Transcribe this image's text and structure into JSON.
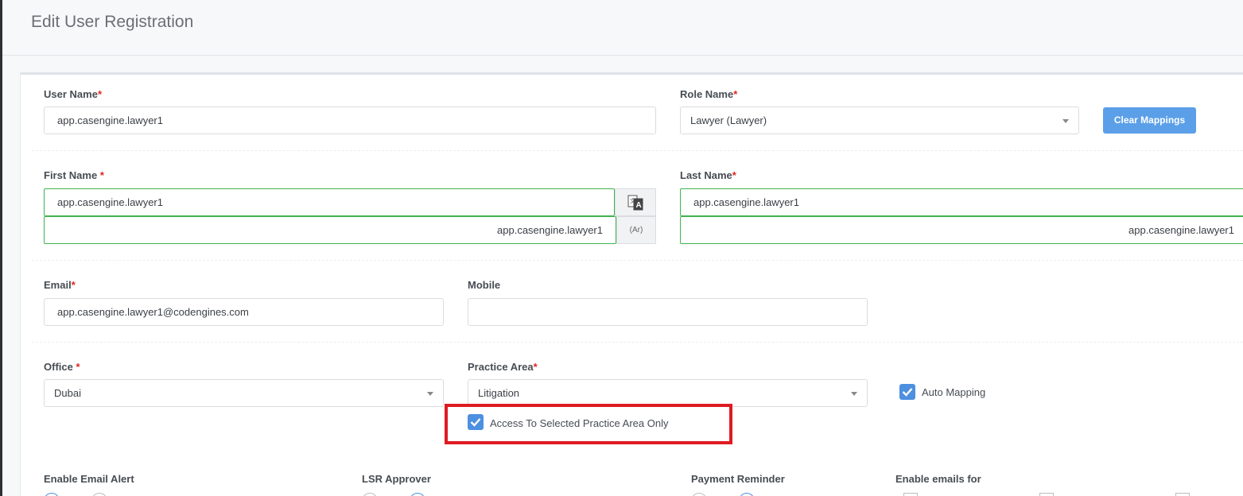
{
  "page": {
    "title": "Edit User Registration"
  },
  "form": {
    "user_name": {
      "label": "User Name",
      "required": "*",
      "value": "app.casengine.lawyer1"
    },
    "role_name": {
      "label": "Role Name",
      "required": "*",
      "value": "Lawyer (Lawyer)"
    },
    "clear_mappings_label": "Clear Mappings",
    "first_name": {
      "label": "First Name ",
      "required": "*",
      "value": "app.casengine.lawyer1",
      "value_ar": "app.casengine.lawyer1",
      "ar_tag": "(Ar)"
    },
    "last_name": {
      "label": "Last Name",
      "required": "*",
      "value": "app.casengine.lawyer1",
      "value_ar": "app.casengine.lawyer1"
    },
    "email": {
      "label": "Email",
      "required": "*",
      "value": "app.casengine.lawyer1@codengines.com"
    },
    "mobile": {
      "label": "Mobile",
      "value": ""
    },
    "office": {
      "label": "Office ",
      "required": "*",
      "value": "Dubai"
    },
    "practice_area": {
      "label": "Practice Area",
      "required": "*",
      "value": "Litigation"
    },
    "auto_mapping": {
      "label": "Auto Mapping",
      "checked": true
    },
    "access_selected_practice_area": {
      "label": "Access To Selected Practice Area Only",
      "checked": true
    },
    "enable_email_alert": {
      "label": "Enable Email Alert"
    },
    "lsr_approver": {
      "label": "LSR Approver"
    },
    "payment_reminder": {
      "label": "Payment Reminder"
    },
    "enable_emails_for": {
      "label": "Enable emails for"
    }
  },
  "icons": {
    "translate": "translate-icon",
    "checkmark": "check-icon",
    "dropdown": "chevron-down-icon"
  },
  "colors": {
    "accent": "#5b9fe8",
    "checkbox": "#4d8fe0",
    "required": "#e02424",
    "valid_border": "#3fb24f",
    "highlight": "#de1b22"
  }
}
